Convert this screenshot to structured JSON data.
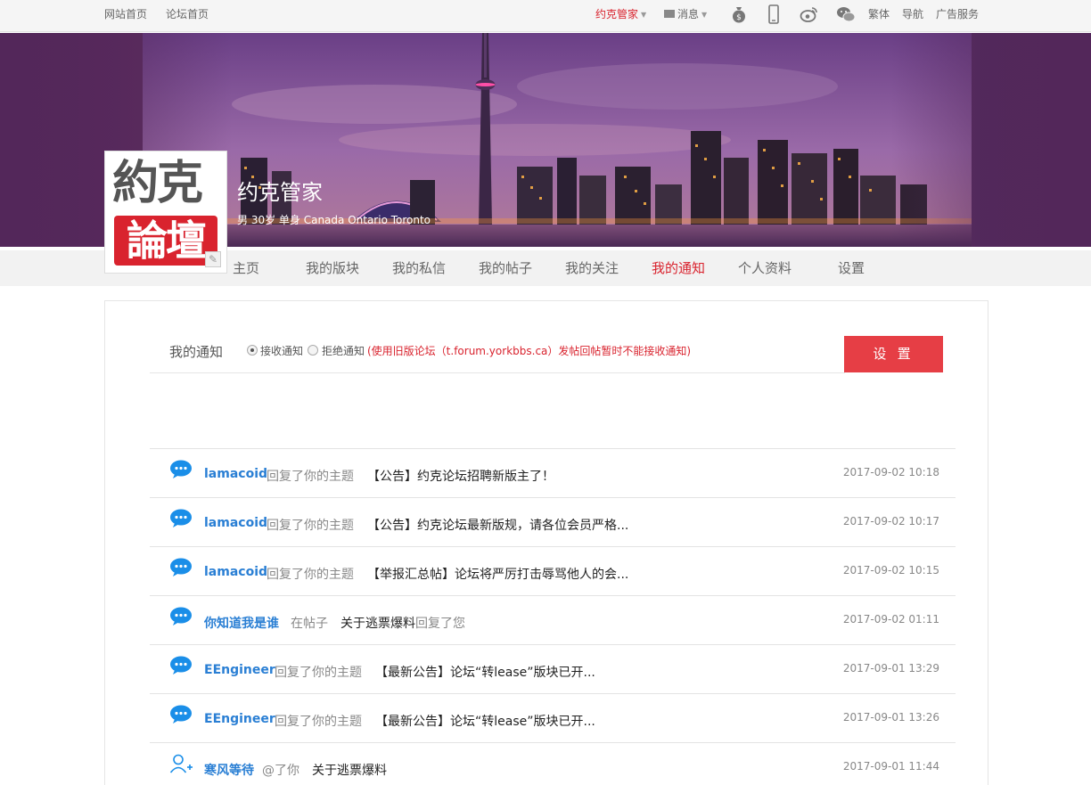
{
  "topbar": {
    "home": "网站首页",
    "forum_home": "论坛首页",
    "user": "约克管家",
    "messages": "消息",
    "traditional": "繁体",
    "navigation": "导航",
    "ad_service": "广告服务"
  },
  "profile": {
    "name": "约克管家",
    "info": "男 30岁 单身 Canada Ontario Toronto",
    "avatar_text_top": "約克",
    "avatar_text_bottom": "論壇"
  },
  "nav": {
    "tabs": [
      "主页",
      "我的版块",
      "我的私信",
      "我的帖子",
      "我的关注",
      "我的通知",
      "个人资料",
      "设置"
    ],
    "active": "我的通知"
  },
  "notify": {
    "title": "我的通知",
    "receive": "接收通知",
    "reject": "拒绝通知",
    "note": "(使用旧版论坛（t.forum.yorkbbs.ca）发帖回帖暂时不能接收通知)",
    "settings_button": "设 置",
    "receive_checked": true
  },
  "notifications": [
    {
      "user": "lamacoid",
      "action": "回复了你的主题",
      "subject": "【公告】约克论坛招聘新版主了！",
      "time": "2017-09-02 10:18",
      "icon": "chat-bubble-icon"
    },
    {
      "user": "lamacoid",
      "action": "回复了你的主题",
      "subject": "【公告】约克论坛最新版规，请各位会员严格...",
      "time": "2017-09-02 10:17",
      "icon": "chat-bubble-icon"
    },
    {
      "user": "lamacoid",
      "action": "回复了你的主题",
      "subject": "【举报汇总帖】论坛将严厉打击辱骂他人的会...",
      "time": "2017-09-02 10:15",
      "icon": "chat-bubble-icon"
    },
    {
      "user": "你知道我是谁",
      "action": "在帖子",
      "subject": "关于逃票爆料",
      "suffix": "回复了您",
      "time": "2017-09-02 01:11",
      "icon": "chat-bubble-icon"
    },
    {
      "user": "EEngineer",
      "action": "回复了你的主题",
      "subject": "【最新公告】论坛“转lease”版块已开...",
      "time": "2017-09-01 13:29",
      "icon": "chat-bubble-icon"
    },
    {
      "user": "EEngineer",
      "action": "回复了你的主题",
      "subject": "【最新公告】论坛“转lease”版块已开...",
      "time": "2017-09-01 13:26",
      "icon": "chat-bubble-icon"
    },
    {
      "user": "寒风等待",
      "action": "@了你",
      "subject": "关于逃票爆料",
      "time": "2017-09-01 11:44",
      "icon": "user-add-icon"
    }
  ],
  "colors": {
    "accent": "#d9232e",
    "button": "#e63e45",
    "link": "#2a7fd4",
    "icon_blue": "#1a8ee8"
  }
}
